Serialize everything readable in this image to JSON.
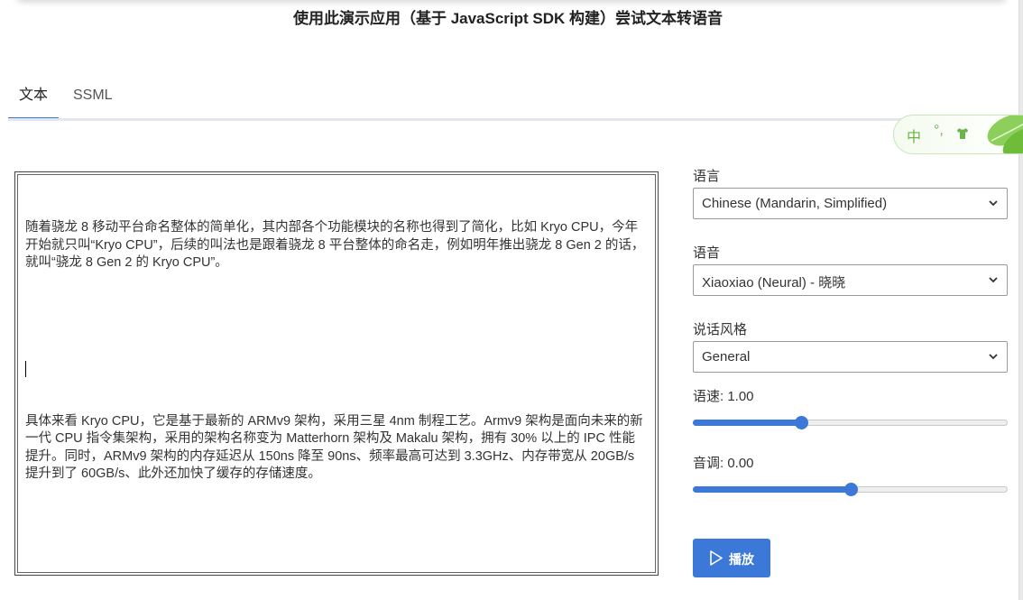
{
  "page_title": "使用此演示应用（基于 JavaScript SDK 构建）尝试文本转语音",
  "tabs": [
    {
      "label": "文本",
      "active": true
    },
    {
      "label": "SSML",
      "active": false
    }
  ],
  "ime": {
    "mode_label": "中",
    "punctuation_label": "°,",
    "accent_color": "#6bb44a"
  },
  "editor": {
    "paragraph_1": "随着骁龙 8 移动平台命名整体的简单化，其内部各个功能模块的名称也得到了简化，比如 Kryo CPU，今年开始就只叫“Kryo CPU”，后续的叫法也是跟着骁龙 8 平台整体的命名走，例如明年推出骁龙 8 Gen 2 的话，就叫“骁龙 8 Gen 2 的 Kryo CPU”。",
    "paragraph_2": "具体来看 Kryo CPU，它是基于最新的 ARMv9 架构，采用三星 4nm 制程工艺。Armv9 架构是面向未来的新一代 CPU 指令集架构，采用的架构名称变为 Matterhorn 架构及 Makalu 架构，拥有 30% 以上的 IPC 性能提升。同时，ARMv9 架构的内存延迟从 150ns 降至 90ns、频率最高可达到 3.3GHz、内存带宽从 20GB/s 提升到了 60GB/s、此外还加快了缓存的存储速度。"
  },
  "settings": {
    "language": {
      "label": "语言",
      "value": "Chinese (Mandarin, Simplified)"
    },
    "voice": {
      "label": "语音",
      "value": "Xiaoxiao (Neural) - 晓晓"
    },
    "style": {
      "label": "说话风格",
      "value": "General"
    },
    "rate": {
      "label": "语速: 1.00",
      "fraction": 0.343
    },
    "pitch": {
      "label": "音调: 0.00",
      "fraction": 0.5
    }
  },
  "play_button": {
    "label": "播放"
  },
  "colors": {
    "accent": "#3c78d8"
  }
}
